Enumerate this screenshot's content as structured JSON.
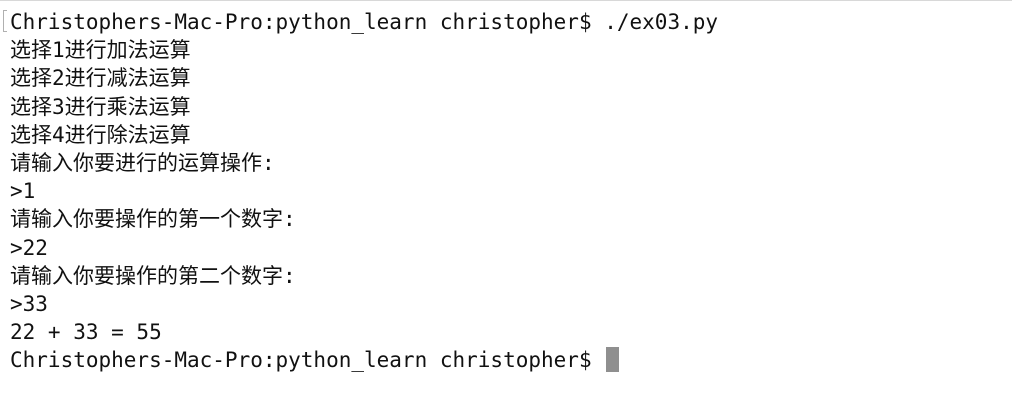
{
  "terminal": {
    "lines": [
      "Christophers-Mac-Pro:python_learn christopher$ ./ex03.py",
      "选择1进行加法运算",
      "选择2进行减法运算",
      "选择3进行乘法运算",
      "选择4进行除法运算",
      "请输入你要进行的运算操作:",
      ">1",
      "请输入你要操作的第一个数字:",
      ">22",
      "请输入你要操作的第二个数字:",
      ">33",
      "22 + 33 = 55"
    ],
    "prompt": "Christophers-Mac-Pro:python_learn christopher$ "
  },
  "colors": {
    "background": "#ffffff",
    "text": "#111111",
    "cursor": "#8f8f8f"
  }
}
